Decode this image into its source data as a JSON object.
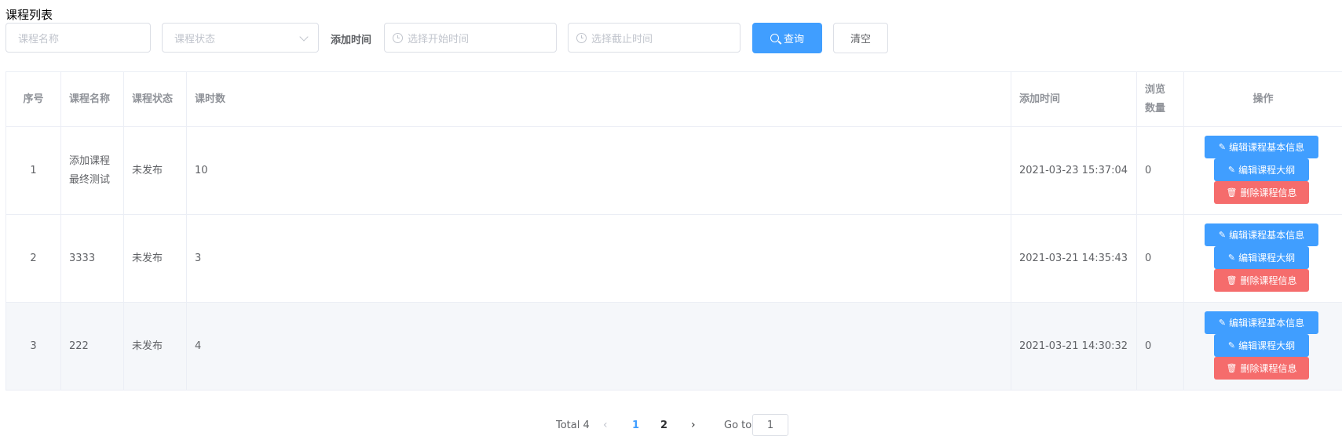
{
  "page_title": "课程列表",
  "filters": {
    "course_name_placeholder": "课程名称",
    "course_status_placeholder": "课程状态",
    "add_time_label": "添加时间",
    "start_time_placeholder": "选择开始时间",
    "end_time_placeholder": "选择截止时间",
    "query_label": "查询",
    "clear_label": "清空"
  },
  "table": {
    "headers": {
      "index": "序号",
      "name": "课程名称",
      "status": "课程状态",
      "hours": "课时数",
      "add_time": "添加时间",
      "views_line1": "浏览",
      "views_line2": "数量",
      "actions": "操作"
    },
    "rows": [
      {
        "index": "1",
        "name_line1": "添加课程",
        "name_line2": "最终测试",
        "status": "未发布",
        "hours": "10",
        "add_time": "2021-03-23 15:37:04",
        "views": "0"
      },
      {
        "index": "2",
        "name_line1": "3333",
        "name_line2": "",
        "status": "未发布",
        "hours": "3",
        "add_time": "2021-03-21 14:35:43",
        "views": "0"
      },
      {
        "index": "3",
        "name_line1": "222",
        "name_line2": "",
        "status": "未发布",
        "hours": "4",
        "add_time": "2021-03-21 14:30:32",
        "views": "0"
      }
    ],
    "actions": {
      "edit_basic": "编辑课程基本信息",
      "edit_outline": "编辑课程大纲",
      "delete": "删除课程信息"
    }
  },
  "pagination": {
    "total": "Total 4",
    "prev": "‹",
    "pages": [
      "1",
      "2"
    ],
    "current": "1",
    "next": "›",
    "goto_label": "Go to",
    "goto_value": "1"
  },
  "colors": {
    "primary": "#409eff",
    "danger": "#f56c6c",
    "highlight_row": "#f5f7fa"
  }
}
